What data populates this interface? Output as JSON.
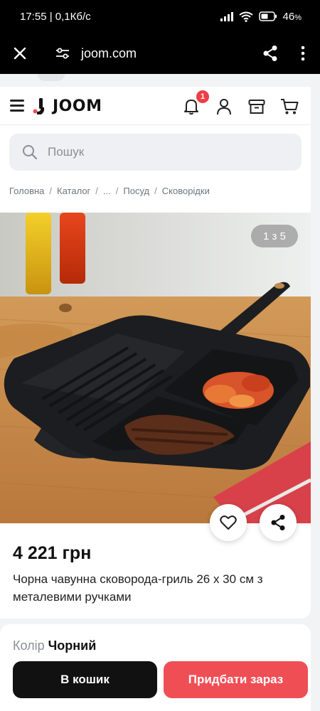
{
  "status_bar": {
    "time_net": "17:55 | 0,1Кб/с",
    "battery": "46",
    "battery_unit": "%"
  },
  "browser": {
    "url": "joom.com"
  },
  "header": {
    "brand": "JOOM",
    "notification_count": "1"
  },
  "search": {
    "placeholder": "Пошук"
  },
  "breadcrumbs": [
    "Головна",
    "Каталог",
    "...",
    "Посуд",
    "Сковорідки"
  ],
  "gallery": {
    "counter": "1 з 5"
  },
  "product": {
    "price": "4 221 грн",
    "name": "Чорна чавунна сковорода-гриль 26 х 30 см з металевими ручками"
  },
  "options": {
    "color_label": "Колір",
    "color_value": "Чорний"
  },
  "actions": {
    "add_to_cart": "В кошик",
    "buy_now": "Придбати зараз"
  },
  "colors": {
    "accent_red": "#f04e55",
    "badge_red": "#ee3e46",
    "dark": "#111111"
  }
}
